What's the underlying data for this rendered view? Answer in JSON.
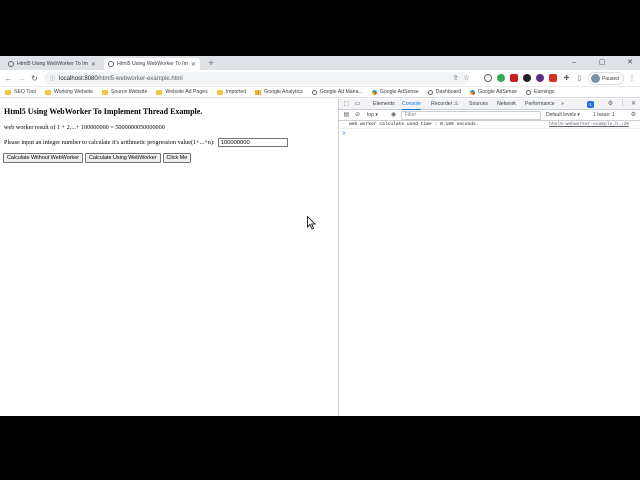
{
  "tabs": [
    {
      "title": "Html5 Using WebWorker To Im",
      "active": false
    },
    {
      "title": "Html5 Using WebWorker To Im",
      "active": true
    }
  ],
  "address_bar": {
    "host": "localhost:8080",
    "path": "/html5-webworker-example.html"
  },
  "profile": {
    "label": "Paused"
  },
  "bookmarks": [
    {
      "label": "SEO Tool",
      "icon": "folder-icon"
    },
    {
      "label": "Working Website",
      "icon": "folder-icon"
    },
    {
      "label": "Source Website",
      "icon": "folder-icon"
    },
    {
      "label": "Website Ad Pages",
      "icon": "folder-icon"
    },
    {
      "label": "Imported",
      "icon": "folder-icon"
    },
    {
      "label": "Google Analytics",
      "icon": "analytics-icon"
    },
    {
      "label": "Google Ad Mana...",
      "icon": "page-icon"
    },
    {
      "label": "Google AdSense",
      "icon": "google-icon"
    },
    {
      "label": "Dashboard",
      "icon": "page-icon"
    },
    {
      "label": "Google AdSense",
      "icon": "google-icon"
    },
    {
      "label": "Earnings",
      "icon": "page-icon"
    }
  ],
  "page": {
    "heading": "Html5 Using WebWorker To Implement Thread Example.",
    "result_text": "web worker result of 1 + 2....+ 100000000 = 5000000050000000",
    "input_prompt": "Please input an integer number to calculate it's arithmetic progression value(1+...+n):",
    "input_value": "100000000",
    "buttons": {
      "without": "Calculate Without WebWorker",
      "using": "Calculate Using WebWorker",
      "click": "Click Me"
    }
  },
  "devtools": {
    "tabs": [
      "Elements",
      "Console",
      "Recorder ⚠",
      "Sources",
      "Network",
      "Performance",
      "»"
    ],
    "active_tab": "Console",
    "badge": "1",
    "context": "top ▾",
    "filter_placeholder": "Filter",
    "levels": "Default levels ▾",
    "issues": "1 Issue: 1",
    "log_message": "web worker calculate used time : 0.189 seconds.",
    "log_source": "html5-webworker-example.h…:20",
    "prompt": ">"
  }
}
